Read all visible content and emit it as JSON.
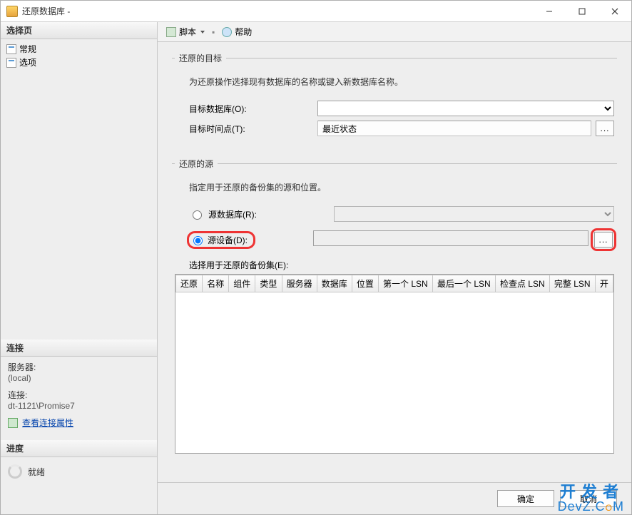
{
  "titlebar": {
    "title": "还原数据库 -"
  },
  "sidebar": {
    "select_header": "选择页",
    "pages": [
      "常规",
      "选项"
    ],
    "connect_header": "连接",
    "server_label": "服务器:",
    "server_value": "(local)",
    "conn_label": "连接:",
    "conn_value": "dt-1121\\Promise7",
    "view_props": "查看连接属性",
    "progress_header": "进度",
    "progress_value": "就绪"
  },
  "toolbar": {
    "script": "脚本",
    "help": "帮助"
  },
  "section_target": {
    "legend": "还原的目标",
    "desc": "为还原操作选择现有数据库的名称或键入新数据库名称。",
    "db_label": "目标数据库(O):",
    "time_label": "目标时间点(T):",
    "time_value": "最近状态"
  },
  "section_source": {
    "legend": "还原的源",
    "desc": "指定用于还原的备份集的源和位置。",
    "src_db_label": "源数据库(R):",
    "src_dev_label": "源设备(D):",
    "sets_label": "选择用于还原的备份集(E):",
    "columns": [
      "还原",
      "名称",
      "组件",
      "类型",
      "服务器",
      "数据库",
      "位置",
      "第一个 LSN",
      "最后一个 LSN",
      "检查点 LSN",
      "完整 LSN",
      "开"
    ]
  },
  "footer": {
    "ok": "确定",
    "cancel": "取消"
  },
  "ellipsis": "..."
}
